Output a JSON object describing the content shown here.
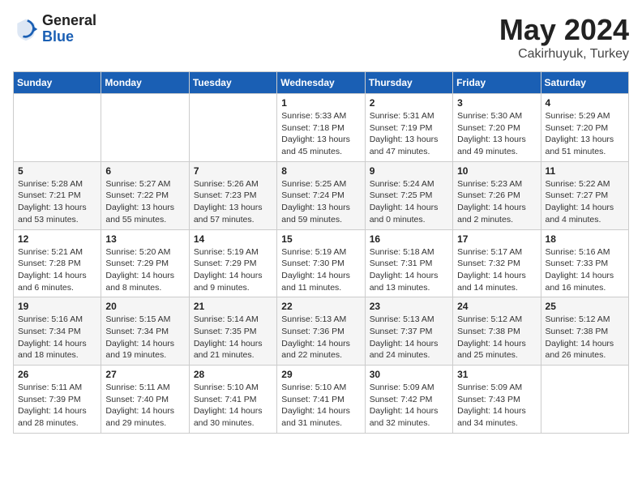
{
  "header": {
    "logo_general": "General",
    "logo_blue": "Blue",
    "title": "May 2024",
    "location": "Cakirhuyuk, Turkey"
  },
  "days_of_week": [
    "Sunday",
    "Monday",
    "Tuesday",
    "Wednesday",
    "Thursday",
    "Friday",
    "Saturday"
  ],
  "weeks": [
    [
      {
        "day": "",
        "info": ""
      },
      {
        "day": "",
        "info": ""
      },
      {
        "day": "",
        "info": ""
      },
      {
        "day": "1",
        "info": "Sunrise: 5:33 AM\nSunset: 7:18 PM\nDaylight: 13 hours\nand 45 minutes."
      },
      {
        "day": "2",
        "info": "Sunrise: 5:31 AM\nSunset: 7:19 PM\nDaylight: 13 hours\nand 47 minutes."
      },
      {
        "day": "3",
        "info": "Sunrise: 5:30 AM\nSunset: 7:20 PM\nDaylight: 13 hours\nand 49 minutes."
      },
      {
        "day": "4",
        "info": "Sunrise: 5:29 AM\nSunset: 7:20 PM\nDaylight: 13 hours\nand 51 minutes."
      }
    ],
    [
      {
        "day": "5",
        "info": "Sunrise: 5:28 AM\nSunset: 7:21 PM\nDaylight: 13 hours\nand 53 minutes."
      },
      {
        "day": "6",
        "info": "Sunrise: 5:27 AM\nSunset: 7:22 PM\nDaylight: 13 hours\nand 55 minutes."
      },
      {
        "day": "7",
        "info": "Sunrise: 5:26 AM\nSunset: 7:23 PM\nDaylight: 13 hours\nand 57 minutes."
      },
      {
        "day": "8",
        "info": "Sunrise: 5:25 AM\nSunset: 7:24 PM\nDaylight: 13 hours\nand 59 minutes."
      },
      {
        "day": "9",
        "info": "Sunrise: 5:24 AM\nSunset: 7:25 PM\nDaylight: 14 hours\nand 0 minutes."
      },
      {
        "day": "10",
        "info": "Sunrise: 5:23 AM\nSunset: 7:26 PM\nDaylight: 14 hours\nand 2 minutes."
      },
      {
        "day": "11",
        "info": "Sunrise: 5:22 AM\nSunset: 7:27 PM\nDaylight: 14 hours\nand 4 minutes."
      }
    ],
    [
      {
        "day": "12",
        "info": "Sunrise: 5:21 AM\nSunset: 7:28 PM\nDaylight: 14 hours\nand 6 minutes."
      },
      {
        "day": "13",
        "info": "Sunrise: 5:20 AM\nSunset: 7:29 PM\nDaylight: 14 hours\nand 8 minutes."
      },
      {
        "day": "14",
        "info": "Sunrise: 5:19 AM\nSunset: 7:29 PM\nDaylight: 14 hours\nand 9 minutes."
      },
      {
        "day": "15",
        "info": "Sunrise: 5:19 AM\nSunset: 7:30 PM\nDaylight: 14 hours\nand 11 minutes."
      },
      {
        "day": "16",
        "info": "Sunrise: 5:18 AM\nSunset: 7:31 PM\nDaylight: 14 hours\nand 13 minutes."
      },
      {
        "day": "17",
        "info": "Sunrise: 5:17 AM\nSunset: 7:32 PM\nDaylight: 14 hours\nand 14 minutes."
      },
      {
        "day": "18",
        "info": "Sunrise: 5:16 AM\nSunset: 7:33 PM\nDaylight: 14 hours\nand 16 minutes."
      }
    ],
    [
      {
        "day": "19",
        "info": "Sunrise: 5:16 AM\nSunset: 7:34 PM\nDaylight: 14 hours\nand 18 minutes."
      },
      {
        "day": "20",
        "info": "Sunrise: 5:15 AM\nSunset: 7:34 PM\nDaylight: 14 hours\nand 19 minutes."
      },
      {
        "day": "21",
        "info": "Sunrise: 5:14 AM\nSunset: 7:35 PM\nDaylight: 14 hours\nand 21 minutes."
      },
      {
        "day": "22",
        "info": "Sunrise: 5:13 AM\nSunset: 7:36 PM\nDaylight: 14 hours\nand 22 minutes."
      },
      {
        "day": "23",
        "info": "Sunrise: 5:13 AM\nSunset: 7:37 PM\nDaylight: 14 hours\nand 24 minutes."
      },
      {
        "day": "24",
        "info": "Sunrise: 5:12 AM\nSunset: 7:38 PM\nDaylight: 14 hours\nand 25 minutes."
      },
      {
        "day": "25",
        "info": "Sunrise: 5:12 AM\nSunset: 7:38 PM\nDaylight: 14 hours\nand 26 minutes."
      }
    ],
    [
      {
        "day": "26",
        "info": "Sunrise: 5:11 AM\nSunset: 7:39 PM\nDaylight: 14 hours\nand 28 minutes."
      },
      {
        "day": "27",
        "info": "Sunrise: 5:11 AM\nSunset: 7:40 PM\nDaylight: 14 hours\nand 29 minutes."
      },
      {
        "day": "28",
        "info": "Sunrise: 5:10 AM\nSunset: 7:41 PM\nDaylight: 14 hours\nand 30 minutes."
      },
      {
        "day": "29",
        "info": "Sunrise: 5:10 AM\nSunset: 7:41 PM\nDaylight: 14 hours\nand 31 minutes."
      },
      {
        "day": "30",
        "info": "Sunrise: 5:09 AM\nSunset: 7:42 PM\nDaylight: 14 hours\nand 32 minutes."
      },
      {
        "day": "31",
        "info": "Sunrise: 5:09 AM\nSunset: 7:43 PM\nDaylight: 14 hours\nand 34 minutes."
      },
      {
        "day": "",
        "info": ""
      }
    ]
  ]
}
